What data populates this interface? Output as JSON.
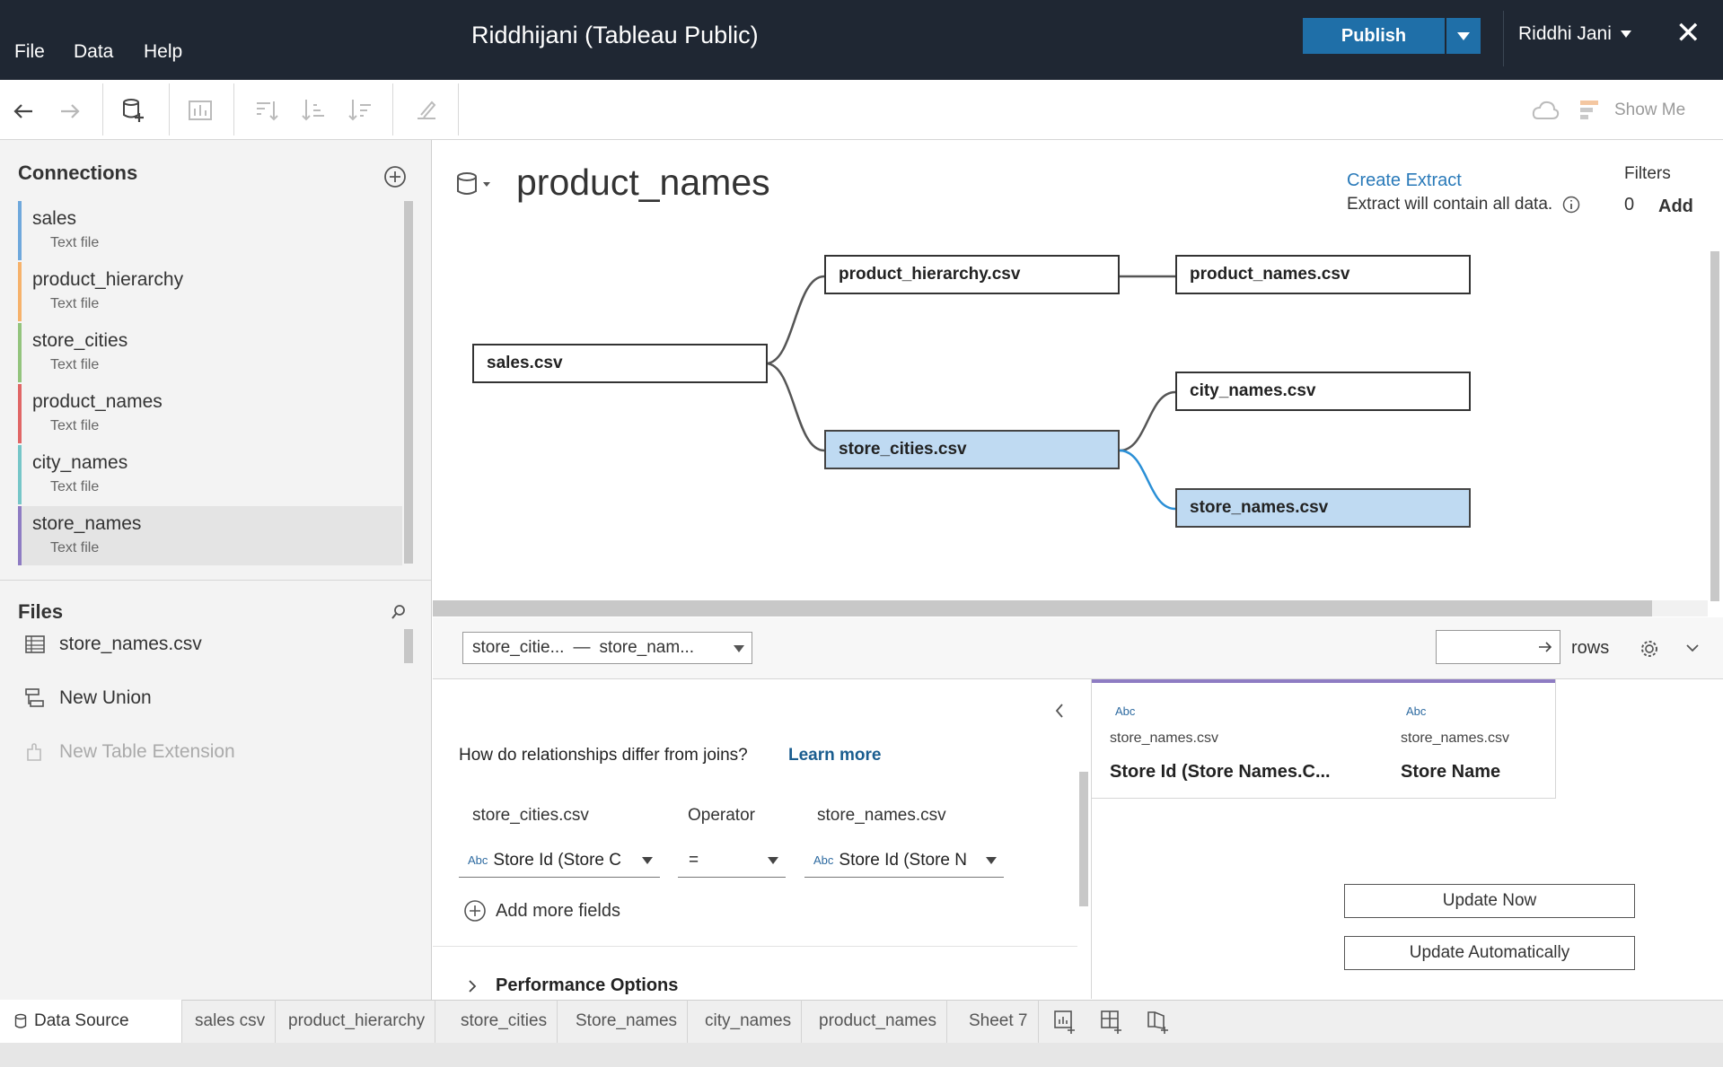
{
  "menu": {
    "file": "File",
    "data": "Data",
    "help": "Help"
  },
  "app_title": "Riddhijani (Tableau Public)",
  "publish": {
    "label": "Publish"
  },
  "user": {
    "name": "Riddhi Jani"
  },
  "toolbar": {
    "show_me": "Show Me"
  },
  "connections": {
    "title": "Connections",
    "items": [
      {
        "name": "sales",
        "type": "Text file",
        "color": "#6fa8dc"
      },
      {
        "name": "product_hierarchy",
        "type": "Text file",
        "color": "#f6b26b"
      },
      {
        "name": "store_cities",
        "type": "Text file",
        "color": "#93c47d"
      },
      {
        "name": "product_names",
        "type": "Text file",
        "color": "#e06666"
      },
      {
        "name": "city_names",
        "type": "Text file",
        "color": "#76c6c8"
      },
      {
        "name": "store_names",
        "type": "Text file",
        "color": "#8e7cc3"
      }
    ]
  },
  "files": {
    "title": "Files",
    "items": [
      {
        "label": "store_names.csv",
        "icon": "table-icon"
      },
      {
        "label": "New Union",
        "icon": "union-icon"
      },
      {
        "label": "New Table Extension",
        "icon": "extension-icon"
      }
    ]
  },
  "canvas": {
    "title": "product_names",
    "create_extract": "Create Extract",
    "extract_note": "Extract will contain all data.",
    "filters_label": "Filters",
    "filters_count": "0",
    "filters_add": "Add",
    "tables": {
      "sales": "sales.csv",
      "product_hierarchy": "product_hierarchy.csv",
      "product_names": "product_names.csv",
      "city_names": "city_names.csv",
      "store_cities": "store_cities.csv",
      "store_names": "store_names.csv"
    }
  },
  "grid": {
    "relation_select": {
      "left": "store_citie...",
      "sep": "—",
      "right": "store_nam..."
    },
    "rows_label": "rows"
  },
  "relationship": {
    "question": "How do relationships differ from joins?",
    "learn_more": "Learn more",
    "left_table": "store_cities.csv",
    "operator_label": "Operator",
    "right_table": "store_names.csv",
    "abc": "Abc",
    "left_field": "Store Id (Store C",
    "operator": "=",
    "right_field": "Store Id (Store N",
    "add_more": "Add more fields",
    "performance": "Performance Options"
  },
  "data_grid": {
    "columns": [
      {
        "type": "Abc",
        "source": "store_names.csv",
        "name": "Store Id (Store Names.C..."
      },
      {
        "type": "Abc",
        "source": "store_names.csv",
        "name": "Store Name"
      }
    ],
    "update_now": "Update Now",
    "update_auto": "Update Automatically"
  },
  "tabs": {
    "data_source": "Data Source",
    "sheets": [
      "sales csv",
      "product_hierarchy",
      "store_cities",
      "Store_names",
      "city_names",
      "product_names",
      "Sheet 7"
    ]
  },
  "colors": {
    "accent": "#1f6fa8",
    "selected_table": "#bfdaf2",
    "link": "#2a7ab9",
    "title_bar": "#1f2733"
  }
}
